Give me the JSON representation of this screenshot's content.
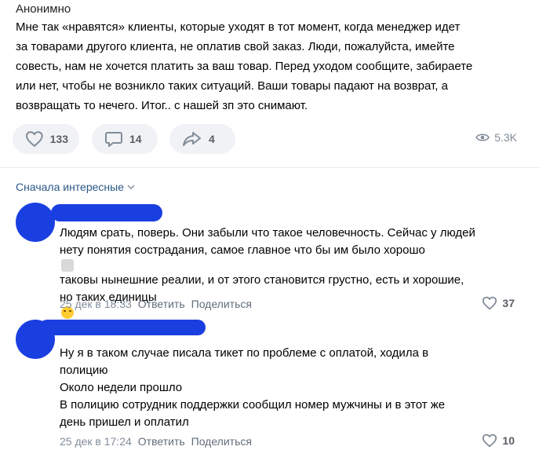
{
  "post": {
    "author": "Анонимно",
    "lines": [
      "Мне так «нравятся» клиенты, которые уходят в тот момент, когда менеджер идет",
      "за товарами другого клиента, не оплатив свой заказ. Люди, пожалуйста, имейте",
      "совесть, нам не хочется платить за ваш товар. Перед уходом сообщите, забираете",
      "или нет, чтобы не возникло таких ситуаций. Ваши товары падают на возврат, а",
      "возвращать то нечего. Итог.. с нашей зп это снимают."
    ],
    "likes": "133",
    "comments": "14",
    "shares": "4",
    "views": "5.3K",
    "icons": {
      "like": "heart-icon",
      "comment": "comment-bubble-icon",
      "share": "share-arrow-icon",
      "views": "eye-icon"
    }
  },
  "sort_label": "Сначала интересные",
  "comments": [
    {
      "lines": [
        "Людям срать, поверь. Они забыли что такое человечность. Сейчас у людей",
        "нету понятия сострадания, самое главное что бы им было хорошо",
        "таковы нынешние реалии, и от этого становится грустно, есть и хорошие,",
        "но таких единицы"
      ],
      "date": "25 дек в 18:33",
      "reply": "Ответить",
      "share": "Поделиться",
      "likes": "37"
    },
    {
      "lines": [
        "Ну я в таком случае писала тикет по проблеме с оплатой, ходила в",
        "полицию",
        "Около недели прошло",
        "В полицию сотрудник поддержки сообщил номер мужчины и в этот же",
        "день пришел и оплатил"
      ],
      "date": "25 дек в 17:24",
      "reply": "Ответить",
      "share": "Поделиться",
      "likes": "10"
    }
  ],
  "colors": {
    "accent_link": "#2a5885",
    "redaction": "#1a3fe0",
    "button_bg": "#f0f2f5",
    "meta": "#818c99"
  }
}
